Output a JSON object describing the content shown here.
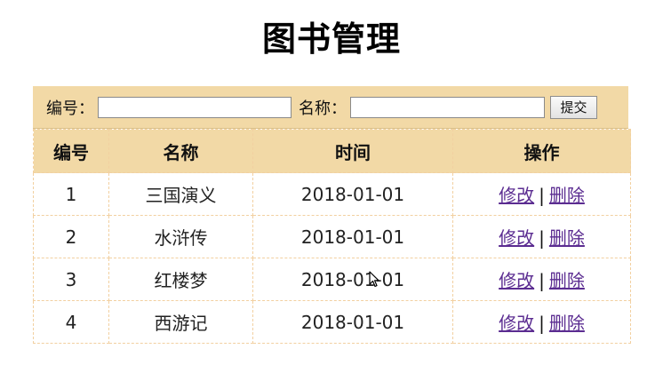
{
  "page": {
    "title": "图书管理"
  },
  "search": {
    "id_label": "编号：",
    "id_value": "",
    "name_label": "名称：",
    "name_value": "",
    "submit_label": "提交"
  },
  "table": {
    "headers": [
      "编号",
      "名称",
      "时间",
      "操作"
    ],
    "edit_label": "修改",
    "separator": "|",
    "delete_label": "删除",
    "rows": [
      {
        "id": "1",
        "name": "三国演义",
        "time": "2018-01-01"
      },
      {
        "id": "2",
        "name": "水浒传",
        "time": "2018-01-01"
      },
      {
        "id": "3",
        "name": "红楼梦",
        "time": "2018-01-01"
      },
      {
        "id": "4",
        "name": "西游记",
        "time": "2018-01-01"
      }
    ]
  },
  "colors": {
    "header_background": "#f2d9a6",
    "border": "#f2d0a0",
    "link": "#5b2c91"
  },
  "icons": {
    "cursor": "mouse-pointer-icon"
  }
}
